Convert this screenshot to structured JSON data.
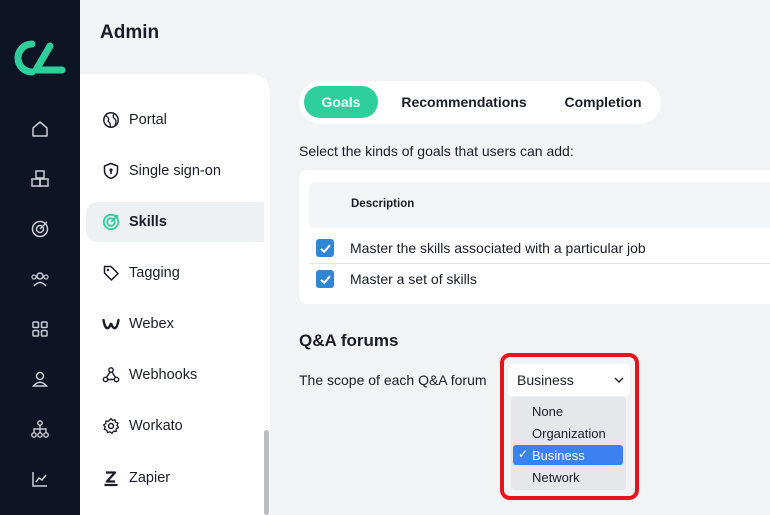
{
  "header": {
    "title": "Admin"
  },
  "rail": {
    "icons": [
      "home-icon",
      "content-icon",
      "goals-icon",
      "users-icon",
      "apps-icon",
      "profile-icon",
      "org-chart-icon",
      "analytics-icon"
    ]
  },
  "sidebar": {
    "items": [
      {
        "label": "Portal",
        "icon": "globe-icon"
      },
      {
        "label": "Single sign-on",
        "icon": "shield-lock-icon"
      },
      {
        "label": "Skills",
        "icon": "target-icon",
        "active": true
      },
      {
        "label": "Tagging",
        "icon": "tag-icon"
      },
      {
        "label": "Webex",
        "icon": "webex-icon"
      },
      {
        "label": "Webhooks",
        "icon": "webhooks-icon"
      },
      {
        "label": "Workato",
        "icon": "gear-icon"
      },
      {
        "label": "Zapier",
        "icon": "zapier-icon"
      }
    ]
  },
  "tabs": [
    {
      "label": "Goals",
      "active": true
    },
    {
      "label": "Recommendations"
    },
    {
      "label": "Completion"
    }
  ],
  "goals": {
    "prompt": "Select the kinds of goals that users can add:",
    "column_header": "Description",
    "rows": [
      {
        "label": "Master the skills associated with a particular job",
        "checked": true
      },
      {
        "label": "Master a set of skills",
        "checked": true
      }
    ]
  },
  "qa": {
    "title": "Q&A forums",
    "scope_label": "The scope of each Q&A forum",
    "selected": "Business",
    "options": [
      "None",
      "Organization",
      "Business",
      "Network"
    ]
  },
  "colors": {
    "accent": "#2fcf9c",
    "rail_bg": "#0d1424",
    "checkbox": "#2f86d6",
    "selected_option": "#3b82f0",
    "highlight": "#e8131a"
  }
}
